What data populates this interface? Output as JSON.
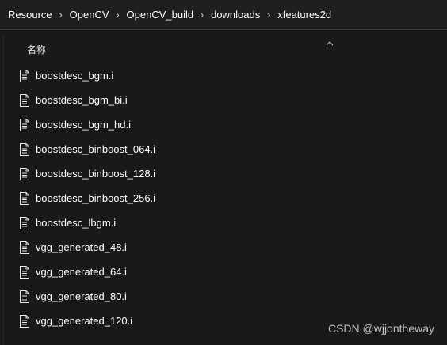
{
  "breadcrumb": {
    "items": [
      "Resource",
      "OpenCV",
      "OpenCV_build",
      "downloads",
      "xfeatures2d"
    ],
    "separator": "›"
  },
  "columns": {
    "name": "名称"
  },
  "files": [
    "boostdesc_bgm.i",
    "boostdesc_bgm_bi.i",
    "boostdesc_bgm_hd.i",
    "boostdesc_binboost_064.i",
    "boostdesc_binboost_128.i",
    "boostdesc_binboost_256.i",
    "boostdesc_lbgm.i",
    "vgg_generated_48.i",
    "vgg_generated_64.i",
    "vgg_generated_80.i",
    "vgg_generated_120.i"
  ],
  "watermark": "CSDN @wjjontheway",
  "icons": {
    "file": "file-document-icon",
    "sort": "chevron-up-icon"
  },
  "colors": {
    "background": "#191919",
    "breadcrumb_bar": "#1f1f1f",
    "text": "#ffffff"
  }
}
